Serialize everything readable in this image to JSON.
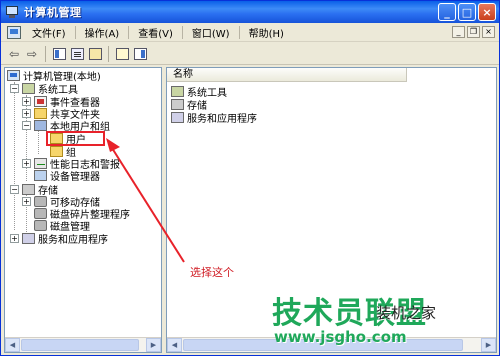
{
  "window": {
    "title": "计算机管理"
  },
  "menubar": {
    "items": [
      "文件(F)",
      "操作(A)",
      "查看(V)",
      "窗口(W)",
      "帮助(H)"
    ]
  },
  "tree": {
    "root": "计算机管理(本地)",
    "system_tools": "系统工具",
    "event_viewer": "事件查看器",
    "shared_folders": "共享文件夹",
    "local_users_groups": "本地用户和组",
    "users": "用户",
    "groups": "组",
    "perf_logs": "性能日志和警报",
    "device_manager": "设备管理器",
    "storage": "存储",
    "removable_storage": "可移动存储",
    "defrag": "磁盘碎片整理程序",
    "disk_mgmt": "磁盘管理",
    "services_apps": "服务和应用程序"
  },
  "list": {
    "column_name": "名称",
    "items": [
      "系统工具",
      "存储",
      "服务和应用程序"
    ]
  },
  "annotation": {
    "text": "选择这个",
    "color": "#d01c24"
  },
  "watermark": {
    "brand": "技术员联盟",
    "sub": "装机之家",
    "url": "www.jsgho.com"
  },
  "colors": {
    "title_bar": "#2a6ff0",
    "selection_box": "#e8222a",
    "watermark_green": "#1fa85a"
  }
}
